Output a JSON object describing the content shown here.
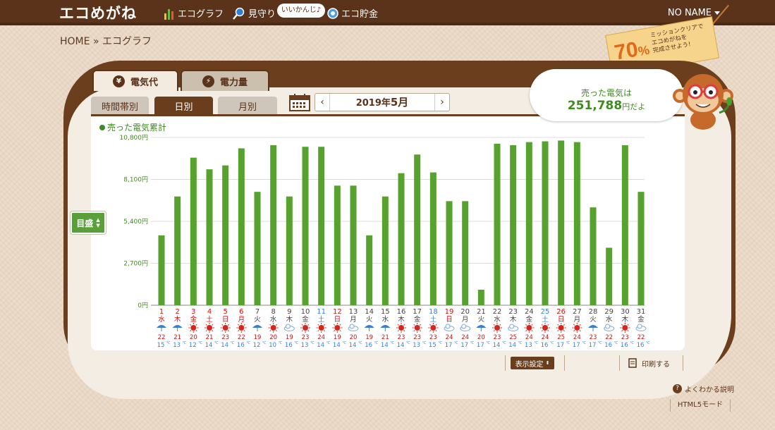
{
  "header": {
    "logo": "エコめがね",
    "nav": [
      {
        "label": "エコグラフ",
        "icon": "bar-graph-icon"
      },
      {
        "label": "見守り",
        "icon": "magnifier-icon"
      },
      {
        "label": "エコ貯金",
        "icon": "coin-icon"
      }
    ],
    "bubble": "いいかんじ♪",
    "user": "NO NAME"
  },
  "breadcrumb": {
    "home": "HOME",
    "sep": "»",
    "current": "エコグラフ"
  },
  "mission": {
    "percent": "70",
    "percent_sign": "%",
    "text_lines": [
      "ミッションクリアで",
      "エコめがねを",
      "完成させよう!"
    ]
  },
  "summary": {
    "line1": "売った電気は",
    "amount": "251,788",
    "unit": "円だよ"
  },
  "tabs": {
    "primary": [
      {
        "label": "電気代",
        "icon": "yen-icon"
      },
      {
        "label": "電力量",
        "icon": "lightning-icon"
      }
    ],
    "secondary": [
      "時間帯別",
      "日別",
      "月別"
    ]
  },
  "date": {
    "year_label": "2019年",
    "month_label": "5月",
    "prev": "‹",
    "next": "›"
  },
  "legend": "売った電気累計",
  "goal_button": "目盛",
  "controls": {
    "display_settings": "表示設定",
    "print": "印刷する",
    "help": "よくわかる説明",
    "html5": "HTML5モード"
  },
  "colors": {
    "bar": "#57a22e",
    "weekday": "#444444",
    "saturday": "#3a7fd5",
    "sunday": "#cc1111"
  },
  "chart_data": {
    "type": "bar",
    "title": "",
    "series": [
      {
        "name": "売った電気累計"
      }
    ],
    "yticks": [
      "0円",
      "2,700円",
      "5,400円",
      "8,100円",
      "10,800円"
    ],
    "ylim": [
      0,
      10800
    ],
    "categories": [
      "1",
      "2",
      "3",
      "4",
      "5",
      "6",
      "7",
      "8",
      "9",
      "10",
      "11",
      "12",
      "13",
      "14",
      "15",
      "16",
      "17",
      "18",
      "19",
      "20",
      "21",
      "22",
      "23",
      "24",
      "25",
      "26",
      "27",
      "28",
      "29",
      "30",
      "31"
    ],
    "weekdays": [
      "水",
      "木",
      "金",
      "土",
      "日",
      "月",
      "火",
      "水",
      "木",
      "金",
      "土",
      "日",
      "月",
      "火",
      "水",
      "木",
      "金",
      "土",
      "日",
      "月",
      "火",
      "水",
      "木",
      "金",
      "土",
      "日",
      "月",
      "火",
      "水",
      "木",
      "金"
    ],
    "day_types": [
      "h",
      "h",
      "h",
      "h",
      "h",
      "h",
      "w",
      "w",
      "w",
      "w",
      "s",
      "h",
      "w",
      "w",
      "w",
      "w",
      "w",
      "s",
      "h",
      "w",
      "w",
      "w",
      "w",
      "w",
      "s",
      "h",
      "w",
      "w",
      "w",
      "w",
      "w"
    ],
    "values": [
      4500,
      7000,
      9500,
      8750,
      9000,
      10100,
      7300,
      10300,
      7000,
      10200,
      10200,
      7700,
      7700,
      4500,
      7000,
      8500,
      9700,
      8550,
      6700,
      6700,
      1000,
      10400,
      10300,
      10500,
      10550,
      10600,
      10500,
      6300,
      3700,
      10300,
      7300
    ],
    "weather": [
      "rain",
      "rain",
      "sun",
      "sun",
      "sun",
      "sun",
      "rain",
      "sun",
      "cloud",
      "sun",
      "sun",
      "sun",
      "cloud",
      "rain",
      "rain",
      "sun",
      "sun",
      "sun",
      "cloud",
      "cloud",
      "rain",
      "sun",
      "cloud",
      "sun",
      "sun",
      "sun",
      "sun",
      "rain",
      "cloud",
      "sun",
      "cloud"
    ],
    "temp_high": [
      "22",
      "21",
      "20",
      "21",
      "23",
      "22",
      "19",
      "20",
      "19",
      "23",
      "24",
      "19",
      "20",
      "19",
      "21",
      "23",
      "23",
      "23",
      "24",
      "24",
      "20",
      "23",
      "25",
      "24",
      "24",
      "25",
      "24",
      "23",
      "22",
      "23",
      "22"
    ],
    "temp_low": [
      "15",
      "13",
      "12",
      "14",
      "14",
      "16",
      "12",
      "10",
      "16",
      "13",
      "14",
      "14",
      "14",
      "16",
      "14",
      "14",
      "13",
      "15",
      "17",
      "17",
      "17",
      "14",
      "14",
      "13",
      "16",
      "17",
      "17",
      "17",
      "16",
      "16",
      "16"
    ],
    "temp_unit": "℃",
    "grid": true
  }
}
